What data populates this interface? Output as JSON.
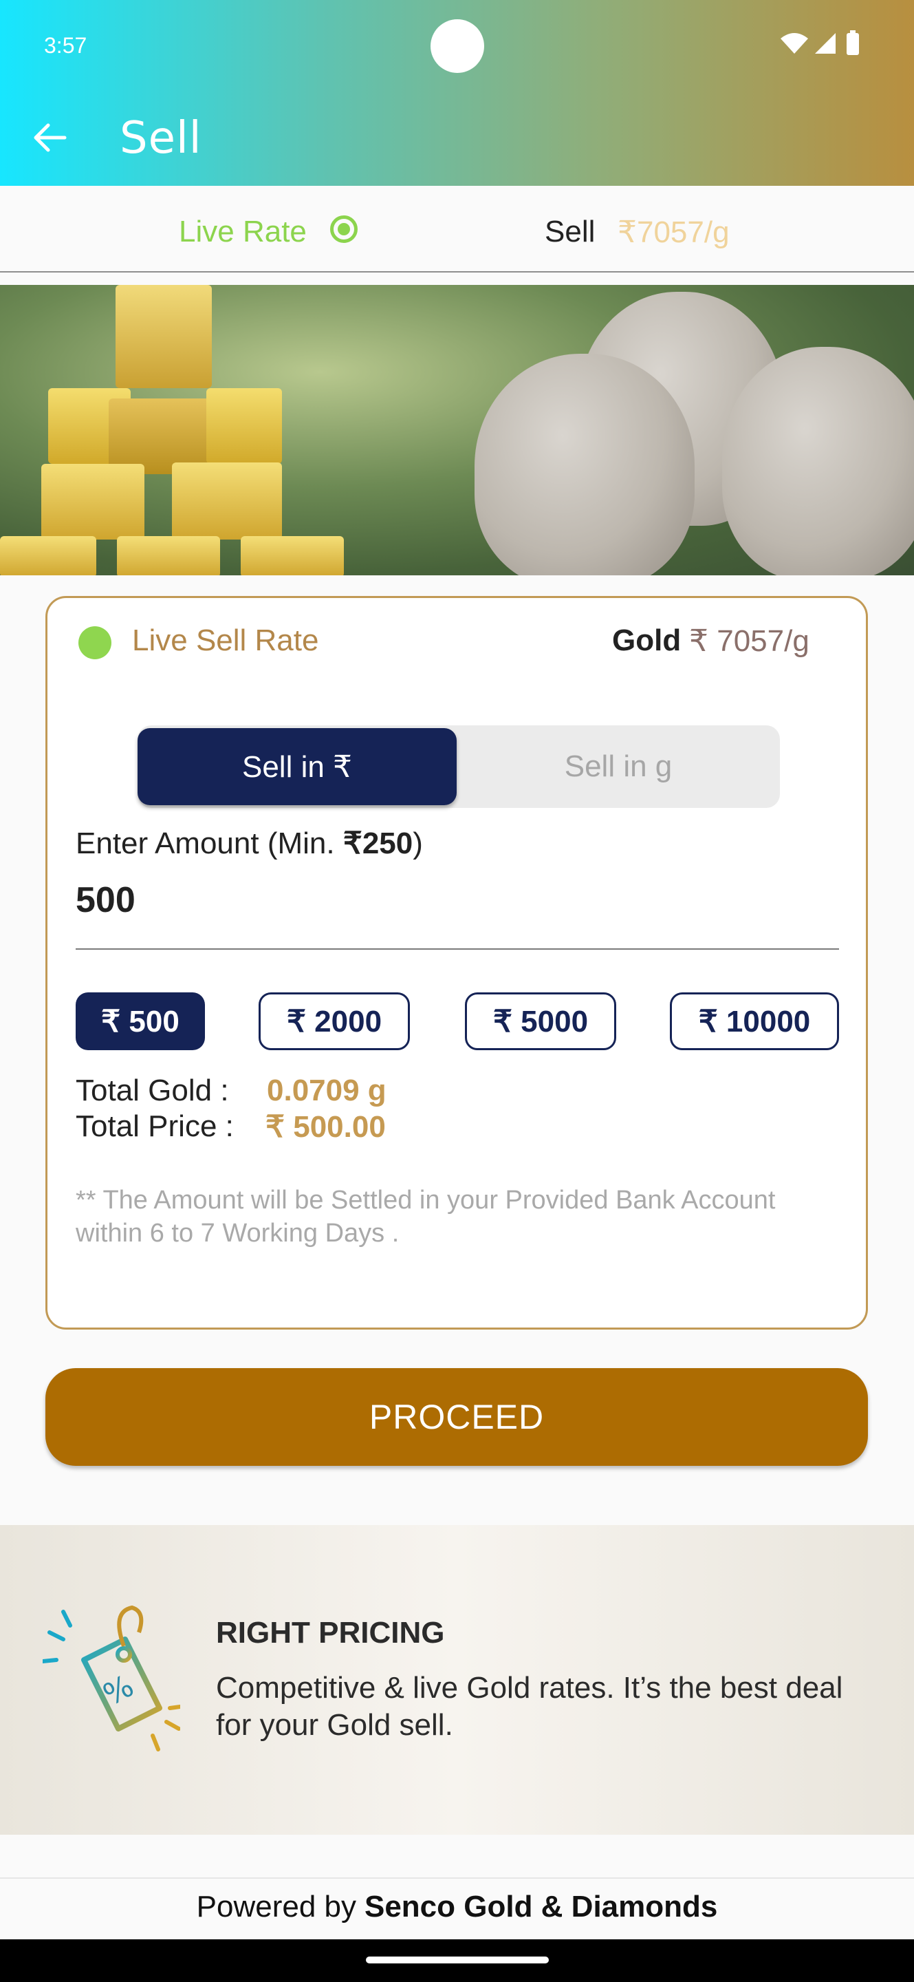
{
  "status_bar": {
    "time": "3:57"
  },
  "header": {
    "title": "Sell"
  },
  "rate_bar": {
    "live_rate_label": "Live Rate",
    "sell_label": "Sell",
    "sell_rate": "₹7057/g"
  },
  "card": {
    "live_sell_rate_label": "Live Sell Rate",
    "gold_label": "Gold",
    "gold_rate": "₹ 7057/g",
    "toggle": {
      "active": "Sell in ₹",
      "inactive": "Sell in g"
    },
    "enter_amount_prefix": "Enter Amount (Min. ",
    "enter_amount_min": "₹250",
    "enter_amount_suffix": ")",
    "amount_value": "500",
    "chips": [
      "₹ 500",
      "₹ 2000",
      "₹ 5000",
      "₹ 10000"
    ],
    "selected_chip": "₹ 500",
    "total_gold_label": "Total Gold :",
    "total_gold_value": "0.0709 g",
    "total_price_label": "Total Price :",
    "total_price_value": "₹ 500.00",
    "note": "** The Amount will be Settled in your Provided Bank Account within 6 to 7 Working Days ."
  },
  "proceed_label": "PROCEED",
  "promo": {
    "title": "RIGHT PRICING",
    "description": "Competitive & live Gold rates. It’s the best deal for your Gold sell."
  },
  "footer": {
    "powered_by": "Powered by",
    "brand": "Senco Gold & Diamonds"
  },
  "colors": {
    "accent_brown": "#ad6c02",
    "navy": "#152356",
    "live_green": "#8cd44d",
    "gold_text": "#c69a52"
  }
}
